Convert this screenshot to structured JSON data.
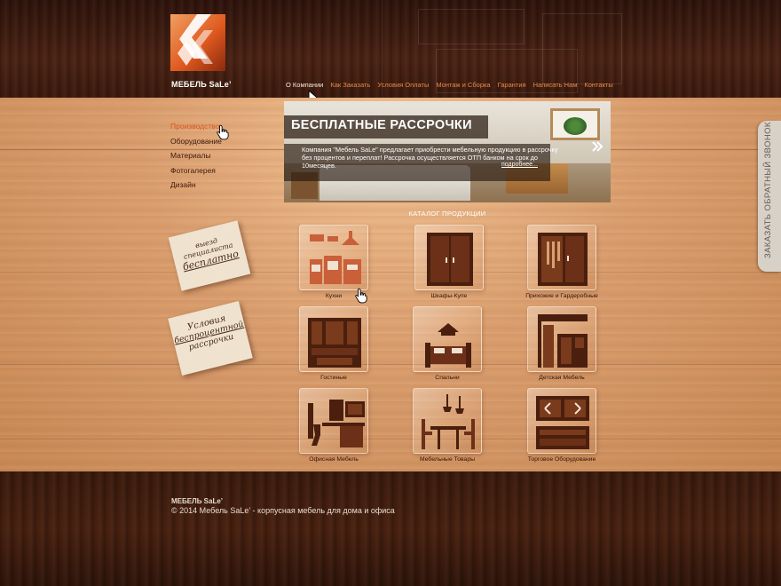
{
  "brand": {
    "logo_text": "МЕБЕЛЬ SaLe’"
  },
  "nav": {
    "items": [
      {
        "label": "О Компании",
        "active": true
      },
      {
        "label": "Как Заказать",
        "active": false
      },
      {
        "label": "Условия Оплаты",
        "active": false
      },
      {
        "label": "Монтаж и Сборка",
        "active": false
      },
      {
        "label": "Гарантия",
        "active": false
      },
      {
        "label": "Написать Нам",
        "active": false
      },
      {
        "label": "Контакты",
        "active": false
      }
    ]
  },
  "sidebar": {
    "items": [
      {
        "label": "Производство",
        "active": true
      },
      {
        "label": "Оборудование",
        "active": false
      },
      {
        "label": "Материалы",
        "active": false
      },
      {
        "label": "Фотогалерея",
        "active": false
      },
      {
        "label": "Дизайн",
        "active": false
      }
    ]
  },
  "notes": {
    "visit": {
      "line1": "выезд специалиста",
      "line2": "бесплатно"
    },
    "credit": {
      "line1": "Условия",
      "line2": "беспроцентной",
      "line3": "рассрочки"
    }
  },
  "banner": {
    "title": "БЕСПЛАТНЫЕ РАССРОЧКИ",
    "text": "Компания \"Мебель SaLe\" предлагает приобрести мебельную продукцию в рассрочку без процентов и переплат! Рассрочка осуществляется ОТП банком на срок до 10месяцев.",
    "more_link": "подробнее...",
    "next_icon": "chevron-right-icon"
  },
  "catalog": {
    "title": "КАТАЛОГ ПРОДУКЦИИ",
    "items": [
      {
        "label": "Кухни",
        "icon": "kitchen-icon"
      },
      {
        "label": "Шкафы-Купе",
        "icon": "wardrobe-icon"
      },
      {
        "label": "Прихожие и Гардеробные",
        "icon": "hallway-icon"
      },
      {
        "label": "Гостиные",
        "icon": "living-room-icon"
      },
      {
        "label": "Спальни",
        "icon": "bed-icon"
      },
      {
        "label": "Детская Мебель",
        "icon": "kids-furniture-icon"
      },
      {
        "label": "Офисная Мебель",
        "icon": "office-icon"
      },
      {
        "label": "Мебельные Товары",
        "icon": "dining-icon"
      },
      {
        "label": "Торговое Оборудование",
        "icon": "retail-icon"
      }
    ]
  },
  "callback": {
    "label": "ЗАКАЗАТЬ ОБРАТНЫЙ ЗВОНОК"
  },
  "footer": {
    "brand": "МЕБЕЛЬ SaLe’",
    "copyright": "© 2014 Мебель SaLe’ - корпусная мебель для дома и офиса"
  },
  "colors": {
    "accent": "#e05a20",
    "nav_text": "#e38a4a",
    "icon_brown": "#4a1f0e"
  }
}
